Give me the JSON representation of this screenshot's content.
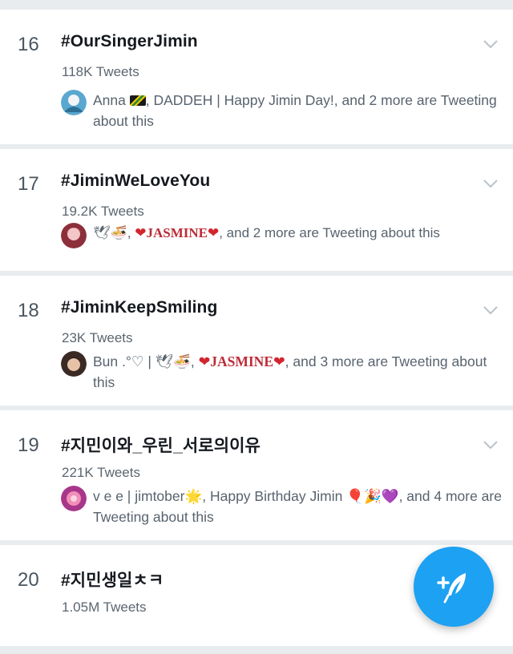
{
  "colors": {
    "background": "#e9ecef",
    "card": "#ffffff",
    "accent": "#1da1f2",
    "heart": "#d3252e"
  },
  "trends": [
    {
      "rank": "16",
      "tag": "#OurSingerJimin",
      "count": "118K Tweets",
      "context": {
        "names": "Anna",
        "flag_icon": "jamaica-flag-icon",
        "rest": ", DADDEH | Happy Jimin Day!, and 2 more are Tweeting about this"
      }
    },
    {
      "rank": "17",
      "tag": "#JiminWeLoveYou",
      "count": "19.2K Tweets",
      "context": {
        "emoji": "🕊🍜,",
        "heart1": "❤",
        "name": "JASMINE",
        "heart2": "❤",
        "rest": ", and 2 more are Tweeting about this"
      }
    },
    {
      "rank": "18",
      "tag": "#JiminKeepSmiling",
      "count": "23K Tweets",
      "context": {
        "prefix": "Bun .°♡ | 🕊🍜,",
        "heart1": "❤",
        "name": "JASMINE",
        "heart2": "❤",
        "rest": ", and 3 more are Tweeting about this"
      }
    },
    {
      "rank": "19",
      "tag": "#지민이와_우린_서로의이유",
      "count": "221K Tweets",
      "context": {
        "prefix": "v e e | jimtober",
        "emoji1": "🌟",
        "middle": ", Happy Birthday Jimin ",
        "emoji2": "🎈🎉💜",
        "rest": ", and 4 more are Tweeting about this"
      }
    },
    {
      "rank": "20",
      "tag": "#지민생일ㅊㅋ",
      "count": "1.05M Tweets"
    }
  ],
  "fab": {
    "icon": "compose-tweet-icon"
  }
}
